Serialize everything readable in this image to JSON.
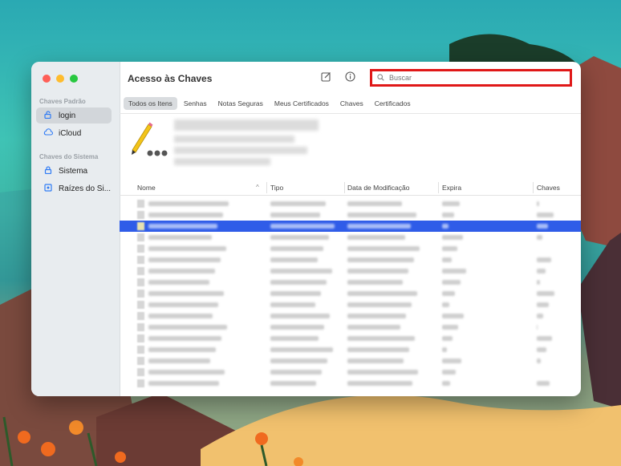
{
  "window": {
    "title": "Acesso às Chaves"
  },
  "sidebar": {
    "sections": [
      {
        "label": "Chaves Padrão",
        "items": [
          {
            "label": "login",
            "icon": "lock-open-icon",
            "active": true
          },
          {
            "label": "iCloud",
            "icon": "cloud-icon",
            "active": false
          }
        ]
      },
      {
        "label": "Chaves do Sistema",
        "items": [
          {
            "label": "Sistema",
            "icon": "lock-icon",
            "active": false
          },
          {
            "label": "Raízes do Si...",
            "icon": "safe-icon",
            "active": false
          }
        ]
      }
    ]
  },
  "toolbar": {
    "compose_icon": "compose-icon",
    "info_icon": "info-icon"
  },
  "search": {
    "placeholder": "Buscar"
  },
  "filters": [
    {
      "label": "Todos os Itens",
      "active": true
    },
    {
      "label": "Senhas",
      "active": false
    },
    {
      "label": "Notas Seguras",
      "active": false
    },
    {
      "label": "Meus Certificados",
      "active": false
    },
    {
      "label": "Chaves",
      "active": false
    },
    {
      "label": "Certificados",
      "active": false
    }
  ],
  "table": {
    "columns": [
      "Nome",
      "Tipo",
      "Data de Modificação",
      "Expira",
      "Chaves"
    ],
    "sort_indicator": "^",
    "row_count": 17,
    "selected_row": 2
  },
  "colors": {
    "accent": "#2f5ce8",
    "highlight_box": "#e01818"
  }
}
